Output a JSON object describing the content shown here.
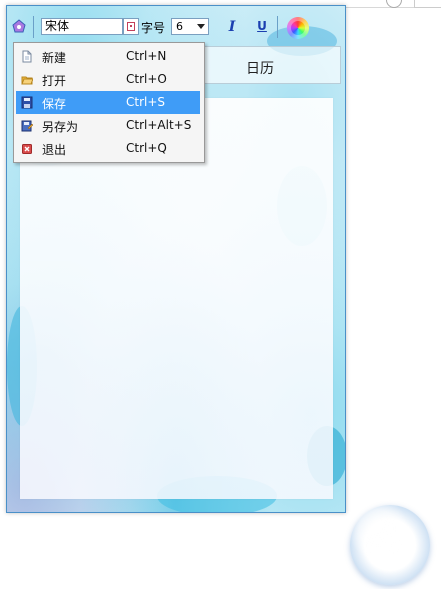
{
  "toolbar": {
    "font_value": "宋体",
    "size_label": "字号",
    "size_value": "6",
    "italic_label": "I",
    "underline_label": "U"
  },
  "header": {
    "calendar_label": "日历"
  },
  "menu": {
    "items": [
      {
        "label": "新建",
        "shortcut": "Ctrl+N",
        "icon": "new-file-icon"
      },
      {
        "label": "打开",
        "shortcut": "Ctrl+O",
        "icon": "open-folder-icon"
      },
      {
        "label": "保存",
        "shortcut": "Ctrl+S",
        "icon": "save-icon",
        "selected": true
      },
      {
        "label": "另存为",
        "shortcut": "Ctrl+Alt+S",
        "icon": "save-as-icon"
      },
      {
        "label": "退出",
        "shortcut": "Ctrl+Q",
        "icon": "exit-icon"
      }
    ]
  },
  "colors": {
    "menu_highlight": "#3f9cf7",
    "format_buttons": "#1b3fb0",
    "window_border": "#4a90c8"
  }
}
